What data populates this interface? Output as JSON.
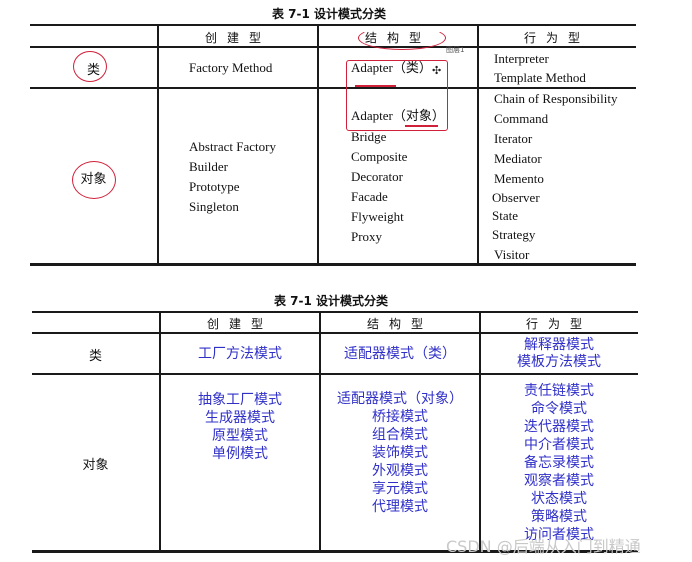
{
  "table1": {
    "caption": "表 7-1   设计模式分类",
    "headers": [
      "创建型",
      "结构型",
      "行为型"
    ],
    "rows": [
      {
        "label": "类",
        "creational": [
          "Factory Method"
        ],
        "structural": [
          "Adapter（类）"
        ],
        "behavioral": [
          "Interpreter",
          "Template Method"
        ]
      },
      {
        "label": "对象",
        "creational": [
          "Abstract Factory",
          "Builder",
          "Prototype",
          "Singleton"
        ],
        "structural": [
          "Adapter（对象）",
          "Bridge",
          "Composite",
          "Decorator",
          "Facade",
          "Flyweight",
          "Proxy"
        ],
        "behavioral": [
          "Chain of Responsibility",
          "Command",
          "Iterator",
          "Mediator",
          "Memento",
          "Observer",
          "State",
          "Strategy",
          "Visitor"
        ]
      }
    ],
    "layer_tag": "图层1",
    "annotation_color": "#d0203a"
  },
  "table2": {
    "caption": "表 7-1   设计模式分类",
    "headers": [
      "创建型",
      "结构型",
      "行为型"
    ],
    "rows": [
      {
        "label": "类",
        "creational": [
          "工厂方法模式"
        ],
        "structural": [
          "适配器模式（类）"
        ],
        "behavioral": [
          "解释器模式",
          "模板方法模式"
        ]
      },
      {
        "label": "对象",
        "creational": [
          "抽象工厂模式",
          "生成器模式",
          "原型模式",
          "单例模式"
        ],
        "structural": [
          "适配器模式（对象）",
          "桥接模式",
          "组合模式",
          "装饰模式",
          "外观模式",
          "享元模式",
          "代理模式"
        ],
        "behavioral": [
          "责任链模式",
          "命令模式",
          "迭代器模式",
          "中介者模式",
          "备忘录模式",
          "观察者模式",
          "状态模式",
          "策略模式",
          "访问者模式"
        ]
      }
    ],
    "text_color": "#3030c8"
  },
  "watermark": "CSDN @后端从入门到精通"
}
